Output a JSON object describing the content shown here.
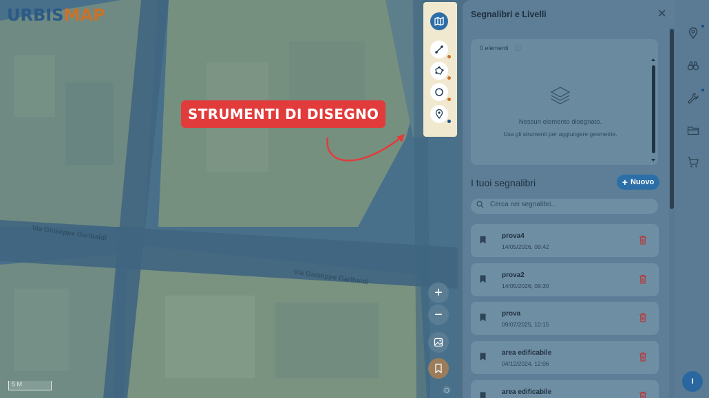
{
  "logo": {
    "part1": "URBIS",
    "part2": "MAP"
  },
  "map": {
    "street_labels": [
      "Via Giuseppe Garibaldi",
      "Via Giuseppe Garibaldi"
    ],
    "scale": "5 M",
    "callout": "STRUMENTI DI DISEGNO"
  },
  "draw_tools": [
    {
      "icon": "map-icon",
      "dot": ""
    },
    {
      "icon": "line-tool-icon",
      "dot": "#c9722b"
    },
    {
      "icon": "polygon-tool-icon",
      "dot": "#c9722b"
    },
    {
      "icon": "circle-tool-icon",
      "dot": "#c9722b"
    },
    {
      "icon": "marker-tool-icon",
      "dot": "#1b4f86"
    }
  ],
  "panel": {
    "title": "Segnalibri e Livelli",
    "elements_count": "0 elementi",
    "empty_title": "Nessun elemento disegnato.",
    "empty_hint": "Usa gli strumenti per aggiungere geometrie.",
    "bookmarks_title": "I tuoi segnalibri",
    "new_button": "Nuovo",
    "search_placeholder": "Cerca nei segnalibri...",
    "bookmarks": [
      {
        "name": "prova4",
        "date": "14/05/2026, 09:42"
      },
      {
        "name": "prova2",
        "date": "14/05/2026, 09:30"
      },
      {
        "name": "prova",
        "date": "09/07/2025, 10:15"
      },
      {
        "name": "area edificabile",
        "date": "04/12/2024, 12:06"
      },
      {
        "name": "area edificabile",
        "date": ""
      }
    ]
  },
  "rail": {
    "icons": [
      "location-pin-icon",
      "binoculars-icon",
      "wrench-icon",
      "folder-icon",
      "cart-icon"
    ],
    "user_initial": "I"
  },
  "colors": {
    "accent": "#2c6fa8",
    "callout": "#e23b3b",
    "delete": "#b33a3a",
    "brand_orange": "#c9722b"
  }
}
